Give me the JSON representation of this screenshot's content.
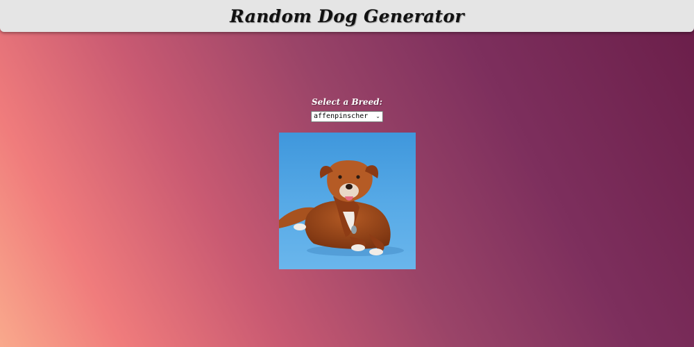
{
  "header": {
    "title": "Random Dog Generator"
  },
  "breed_picker": {
    "label": "Select a Breed:",
    "selected": "affenpinscher",
    "dropdown_icon": "chevron-down-icon"
  },
  "dog_image": {
    "alt": "dog photo"
  },
  "colors": {
    "header_bg": "#e5e5e5",
    "gradient_start": "#f9a98c",
    "gradient_end": "#6a1e49",
    "photo_bg": "#4fa3e0"
  }
}
